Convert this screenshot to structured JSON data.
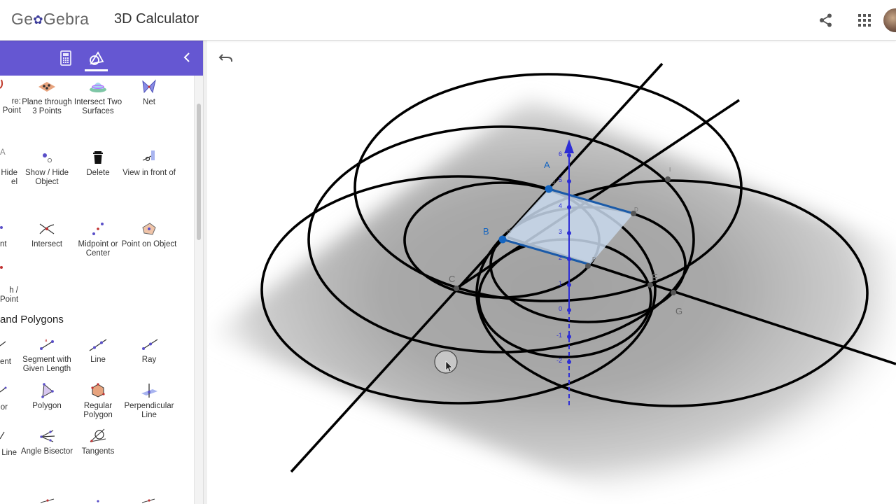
{
  "header": {
    "logo_text_1": "Ge",
    "logo_knot": "✿",
    "logo_text_2": "Gebra",
    "app_title": "3D Calculator"
  },
  "sidebar": {
    "tabs": [
      "algebra",
      "tools"
    ],
    "active_tab": "tools",
    "section_title": "and Polygons",
    "clipped_labels": [
      {
        "id": "clip-1",
        "lines": [
          "re:",
          "Point"
        ]
      },
      {
        "id": "clip-2",
        "lines": [
          "Hide",
          "el"
        ]
      },
      {
        "id": "clip-3",
        "lines": [
          "nt"
        ]
      },
      {
        "id": "clip-4",
        "lines": [
          "h /",
          "Point"
        ]
      },
      {
        "id": "clip-5",
        "lines": [
          "ent"
        ]
      },
      {
        "id": "clip-6",
        "lines": [
          "or"
        ]
      },
      {
        "id": "clip-7",
        "lines": [
          "Line"
        ]
      }
    ],
    "tools": [
      {
        "name": "plane-through-3-points",
        "label": "Plane through 3 Points"
      },
      {
        "name": "intersect-two-surfaces",
        "label": "Intersect Two Surfaces"
      },
      {
        "name": "net",
        "label": "Net"
      },
      {
        "name": "show-hide-object",
        "label": "Show / Hide Object"
      },
      {
        "name": "delete",
        "label": "Delete"
      },
      {
        "name": "view-in-front-of",
        "label": "View in front of"
      },
      {
        "name": "intersect",
        "label": "Intersect"
      },
      {
        "name": "midpoint-or-center",
        "label": "Midpoint or Center"
      },
      {
        "name": "point-on-object",
        "label": "Point on Object"
      },
      {
        "name": "segment-with-given-length",
        "label": "Segment with Given Length"
      },
      {
        "name": "line",
        "label": "Line"
      },
      {
        "name": "ray",
        "label": "Ray"
      },
      {
        "name": "polygon",
        "label": "Polygon"
      },
      {
        "name": "regular-polygon",
        "label": "Regular Polygon"
      },
      {
        "name": "perpendicular-line",
        "label": "Perpendicular Line"
      },
      {
        "name": "angle-bisector",
        "label": "Angle Bisector"
      },
      {
        "name": "tangents",
        "label": "Tangents"
      }
    ]
  },
  "graphics": {
    "point_labels": {
      "A": "A",
      "B": "B",
      "C": "C",
      "E": "E",
      "G": "G"
    },
    "vertex_labels": {
      "D": "D",
      "H": "H",
      "F": "F",
      "I": "I",
      "J": "J"
    },
    "z_axis_ticks": [
      "6",
      "5",
      "4",
      "3",
      "2",
      "1",
      "0",
      "-1",
      "-2"
    ],
    "colors": {
      "axis": "#2d2dd6",
      "point": "#1565c0",
      "segment": "#1a5aa8",
      "polygon_fill": "#c8d8ec",
      "plane": "#9a9a9a",
      "curves": "#000000"
    }
  },
  "icons": {
    "share": "share-icon",
    "apps": "apps-grid-icon",
    "undo": "undo-icon",
    "collapse": "chevron-left-icon",
    "cursor": "mouse-cursor-icon"
  }
}
